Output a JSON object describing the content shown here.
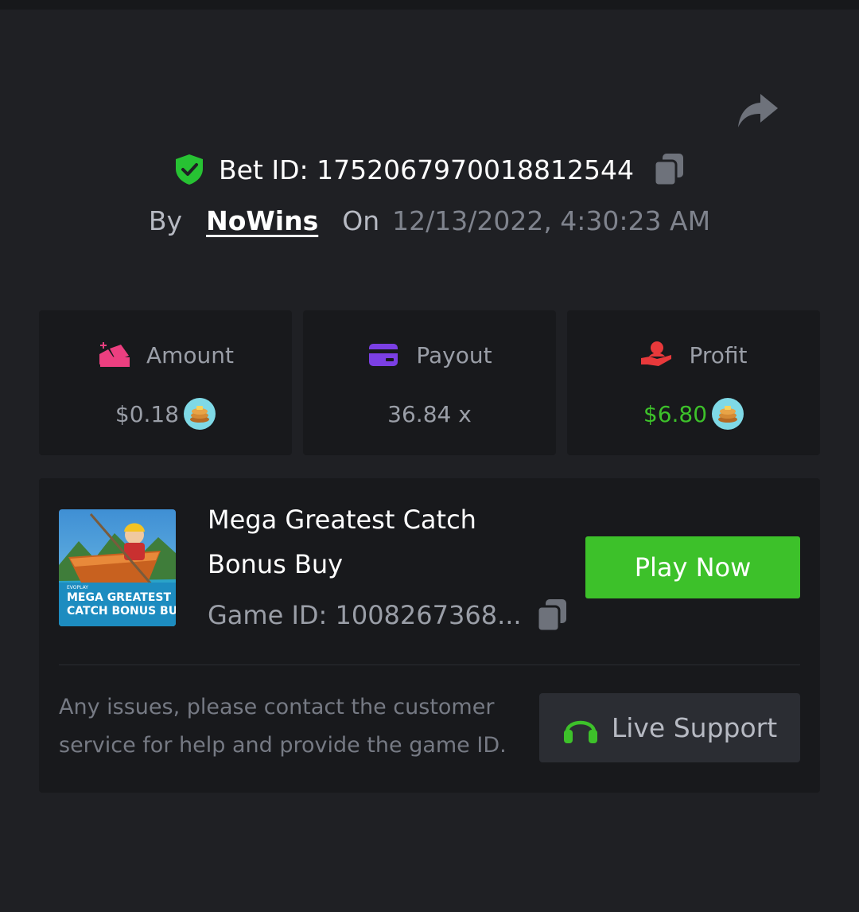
{
  "bet": {
    "id_label": "Bet ID: 1752067970018812544",
    "by_label": "By",
    "username": "NoWins",
    "on_label": "On",
    "datetime": "12/13/2022, 4:30:23 AM"
  },
  "stats": {
    "amount": {
      "label": "Amount",
      "value": "$0.18"
    },
    "payout": {
      "label": "Payout",
      "value": "36.84 x"
    },
    "profit": {
      "label": "Profit",
      "value": "$6.80"
    }
  },
  "game": {
    "name": "Mega Greatest Catch Bonus Buy",
    "id_label": "Game ID: 1008267368...",
    "play_label": "Play Now",
    "thumb": {
      "brand": "EVOPLAY",
      "line1": "MEGA GREATEST",
      "line2": "CATCH BONUS BUY"
    }
  },
  "support": {
    "notice": "Any issues, please contact the customer service for help and provide the game ID.",
    "button_label": "Live Support"
  },
  "colors": {
    "background": "#1f2024",
    "card": "#18191c",
    "accent_green": "#3dc12a",
    "amount_icon": "#ec3f80",
    "payout_icon": "#7b3fe4",
    "profit_icon": "#e8393b"
  },
  "icons": [
    "share-icon",
    "verified-shield-icon",
    "copy-icon",
    "amount-icon",
    "payout-card-icon",
    "profit-hand-icon",
    "pancake-coin-icon",
    "headset-icon"
  ]
}
